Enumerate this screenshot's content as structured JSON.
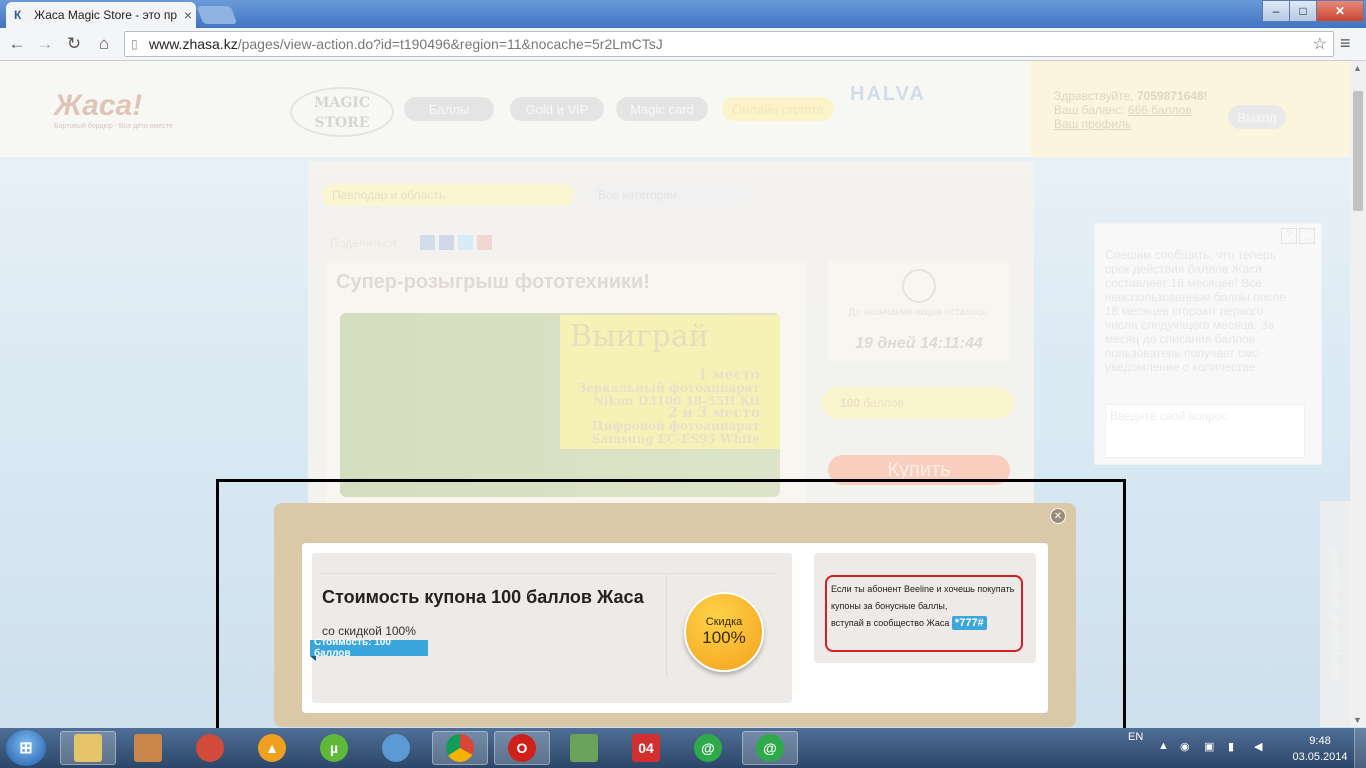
{
  "browser": {
    "tab_title": "Жаса Magic Store - это пр",
    "url_domain": "www.zhasa.kz",
    "url_path": "/pages/view-action.do?id=t190496&region=11&nocache=5r2LmCTsJ"
  },
  "site": {
    "logo": "Жаса!",
    "logo_sub": "Бартовый бордюр - Все дети вместе",
    "magic_store": "MAGIC STORE",
    "nav": [
      "Баллы",
      "Gold и VIP",
      "Magic card",
      "Онлайн оплата"
    ],
    "halva": "HALVA",
    "user": {
      "greeting": "Здравствуйте,",
      "phone": "7059871648!",
      "balance_label": "Ваш баланс:",
      "balance_value": "666 баллов",
      "profile_link": "Ваш профиль",
      "logout": "Выход"
    }
  },
  "content": {
    "region_select": "Павлодар и область",
    "category_select": "Все категории",
    "share_label": "Поделиться:",
    "title": "Супер-розыгрыш фототехники!",
    "promo": {
      "headline": "Выиграй",
      "place1": "1 место",
      "place1_item_a": "Зеркальный фотоаппарат",
      "place1_item_b": "Nikon D3100 18-55II Kit",
      "place23": "2 и 3 место",
      "place23_item_a": "Цифровой фотоаппарат",
      "place23_item_b": "Samsung EC-ES95 White"
    },
    "timer_label": "До окончания акции осталось:",
    "timer_value": "19 дней 14:11:44",
    "balls_value": "100",
    "balls_unit": "баллов",
    "buy_label": "Купить"
  },
  "chat": {
    "message": "Спешим сообщить, что теперь срок действия баллов Жаса составляет 18 месяцев! Все неиспользованные баллы после 18 месяцев сгорают первого числа следующего месяца. За месяц до списания баллов пользователь получает смс-уведомление о количестве",
    "input_placeholder": "Введите свой вопрос",
    "consultant_tab": "Виртуальный консультант"
  },
  "modal": {
    "title": "Стоимость купона 100 баллов Жаса",
    "subtitle": "со скидкой 100%",
    "price_tag": "Стоимость: 100 баллов",
    "discount_label": "Скидка",
    "discount_value": "100%",
    "beeline_line1": "Если ты абонент Beeline и хочешь покупать",
    "beeline_line2": "купоны за бонусные баллы,",
    "beeline_line3": "вступай в сообщество Жаса",
    "beeline_code": "*777#"
  },
  "taskbar": {
    "lang": "EN",
    "time": "9:48",
    "date": "03.05.2014",
    "calendar_day": "04"
  },
  "colors": {
    "accent_blue": "#3aa6dc",
    "modal_bg": "#d9c9a9",
    "discount_gold": "#f3a21c",
    "beeline_border": "#d42020"
  }
}
